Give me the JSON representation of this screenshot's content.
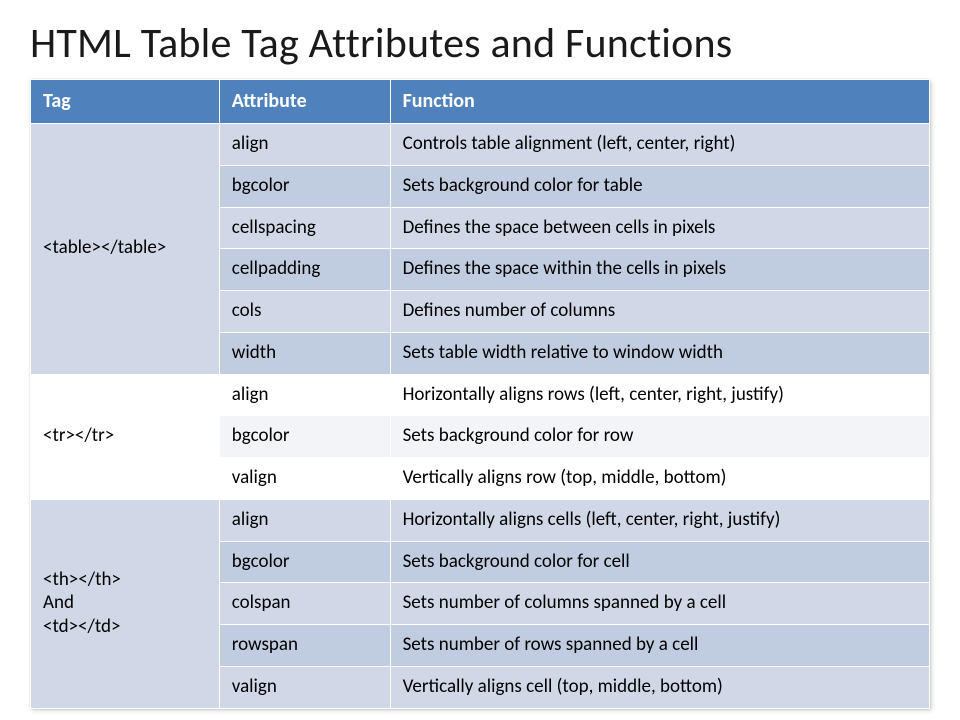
{
  "title": "HTML Table Tag Attributes and Functions",
  "headers": {
    "tag": "Tag",
    "attribute": "Attribute",
    "function": "Function"
  },
  "groups": [
    {
      "band": "a",
      "tag_lines": [
        "<table></table>"
      ],
      "rows": [
        {
          "attr": "align",
          "func": "Controls table alignment (left, center, right)"
        },
        {
          "attr": "bgcolor",
          "func": "Sets background color for table"
        },
        {
          "attr": "cellspacing",
          "func": "Defines the space between cells in pixels"
        },
        {
          "attr": "cellpadding",
          "func": "Defines the space within the cells in pixels"
        },
        {
          "attr": "cols",
          "func": "Defines number of columns"
        },
        {
          "attr": "width",
          "func": "Sets table width relative to window width"
        }
      ]
    },
    {
      "band": "b",
      "tag_lines": [
        "<tr></tr>"
      ],
      "rows": [
        {
          "attr": "align",
          "func": "Horizontally aligns rows (left, center, right, justify)"
        },
        {
          "attr": "bgcolor",
          "func": "Sets background color for row"
        },
        {
          "attr": "valign",
          "func": "Vertically aligns row (top, middle, bottom)"
        }
      ]
    },
    {
      "band": "a",
      "tag_lines": [
        "<th></th>",
        "And",
        "<td></td>"
      ],
      "rows": [
        {
          "attr": "align",
          "func": "Horizontally aligns cells (left, center, right,  justify)"
        },
        {
          "attr": "bgcolor",
          "func": "Sets background color for cell"
        },
        {
          "attr": "colspan",
          "func": "Sets number of columns spanned by a cell"
        },
        {
          "attr": "rowspan",
          "func": "Sets number of rows spanned by a cell"
        },
        {
          "attr": "valign",
          "func": "Vertically aligns cell (top, middle, bottom)"
        }
      ]
    }
  ]
}
